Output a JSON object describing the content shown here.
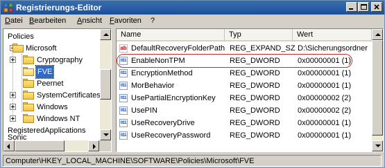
{
  "window": {
    "title": "Registrierungs-Editor",
    "accent_color": "#2b5fa8",
    "icon": "regedit-icon"
  },
  "menu": {
    "items": [
      {
        "label": "Datei"
      },
      {
        "label": "Bearbeiten"
      },
      {
        "label": "Ansicht"
      },
      {
        "label": "Favoriten"
      },
      {
        "label": "?"
      }
    ]
  },
  "tree": {
    "nodes": [
      {
        "label": "Policies",
        "expander": "none",
        "icon": "none"
      },
      {
        "label": "Microsoft",
        "expander": "minus",
        "icon": "folder-icon"
      },
      {
        "label": "Cryptography",
        "expander": "plus",
        "icon": "folder-icon"
      },
      {
        "label": "FVE",
        "expander": "none",
        "icon": "folder-open-icon",
        "selected": true
      },
      {
        "label": "Peernet",
        "expander": "none",
        "icon": "folder-icon"
      },
      {
        "label": "SystemCertificates",
        "expander": "plus",
        "icon": "folder-icon"
      },
      {
        "label": "Windows",
        "expander": "plus",
        "icon": "folder-icon"
      },
      {
        "label": "Windows NT",
        "expander": "plus",
        "icon": "folder-icon"
      },
      {
        "label": "RegisteredApplications",
        "expander": "none",
        "icon": "none"
      },
      {
        "label": "Sonic",
        "expander": "none",
        "icon": "none"
      }
    ]
  },
  "list": {
    "columns": {
      "name": "Name",
      "type": "Typ",
      "data": "Wert"
    },
    "rows": [
      {
        "icon": "string-value-icon",
        "name": "DefaultRecoveryFolderPath",
        "type": "REG_EXPAND_SZ",
        "data": "D:\\Sicherungsordner"
      },
      {
        "icon": "dword-value-icon",
        "name": "EnableNonTPM",
        "type": "REG_DWORD",
        "data": "0x00000001 (1)",
        "highlighted": true
      },
      {
        "icon": "dword-value-icon",
        "name": "EncryptionMethod",
        "type": "REG_DWORD",
        "data": "0x00000001 (1)"
      },
      {
        "icon": "dword-value-icon",
        "name": "MorBehavior",
        "type": "REG_DWORD",
        "data": "0x00000001 (1)"
      },
      {
        "icon": "dword-value-icon",
        "name": "UsePartialEncryptionKey",
        "type": "REG_DWORD",
        "data": "0x00000002 (2)"
      },
      {
        "icon": "dword-value-icon",
        "name": "UsePIN",
        "type": "REG_DWORD",
        "data": "0x00000002 (2)"
      },
      {
        "icon": "dword-value-icon",
        "name": "UseRecoveryDrive",
        "type": "REG_DWORD",
        "data": "0x00000001 (1)"
      },
      {
        "icon": "dword-value-icon",
        "name": "UseRecoveryPassword",
        "type": "REG_DWORD",
        "data": "0x00000001 (1)"
      }
    ],
    "highlight_color": "#c0302a"
  },
  "statusbar": {
    "path": "Computer\\HKEY_LOCAL_MACHINE\\SOFTWARE\\Policies\\Microsoft\\FVE"
  },
  "icons": {
    "string_glyph": "ab",
    "dword_glyph": "011"
  }
}
